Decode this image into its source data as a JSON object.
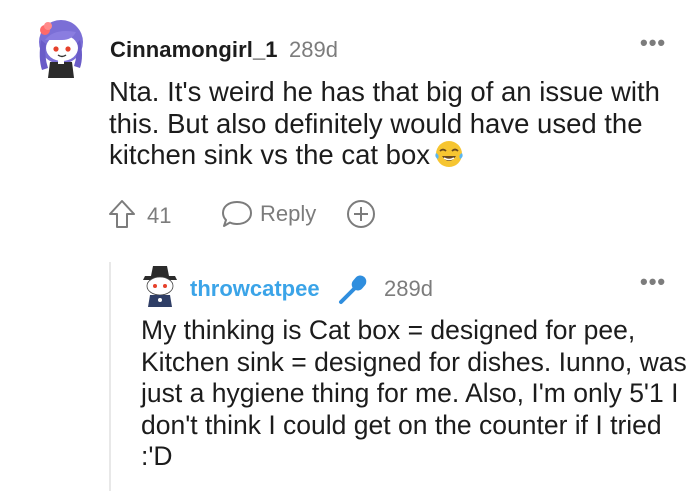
{
  "comment": {
    "username": "Cinnamongirl_1",
    "age": "289d",
    "more_label": "•••",
    "body": "Nta. It's weird he has that big of an issue with this. But also definitely would have used the kitchen sink vs the cat box",
    "emoji_icon": "face-with-tears-of-joy-icon",
    "votes": "41",
    "reply_label": "Reply",
    "award_icon": "plus-circle-icon"
  },
  "reply": {
    "username": "throwcatpee",
    "flair_icon": "microphone-icon",
    "age": "289d",
    "more_label": "•••",
    "body": "My thinking is Cat box = designed for pee, Kitchen sink = designed for dishes. Iunno, was just a hygiene thing for me. Also, I'm only 5'1 I don't think I could get on the counter if I tried :'D"
  },
  "colors": {
    "text": "#1c1c1c",
    "meta": "#7c7c7c",
    "username_link": "#3ba4e8",
    "thread_line": "#e8e8e8"
  }
}
